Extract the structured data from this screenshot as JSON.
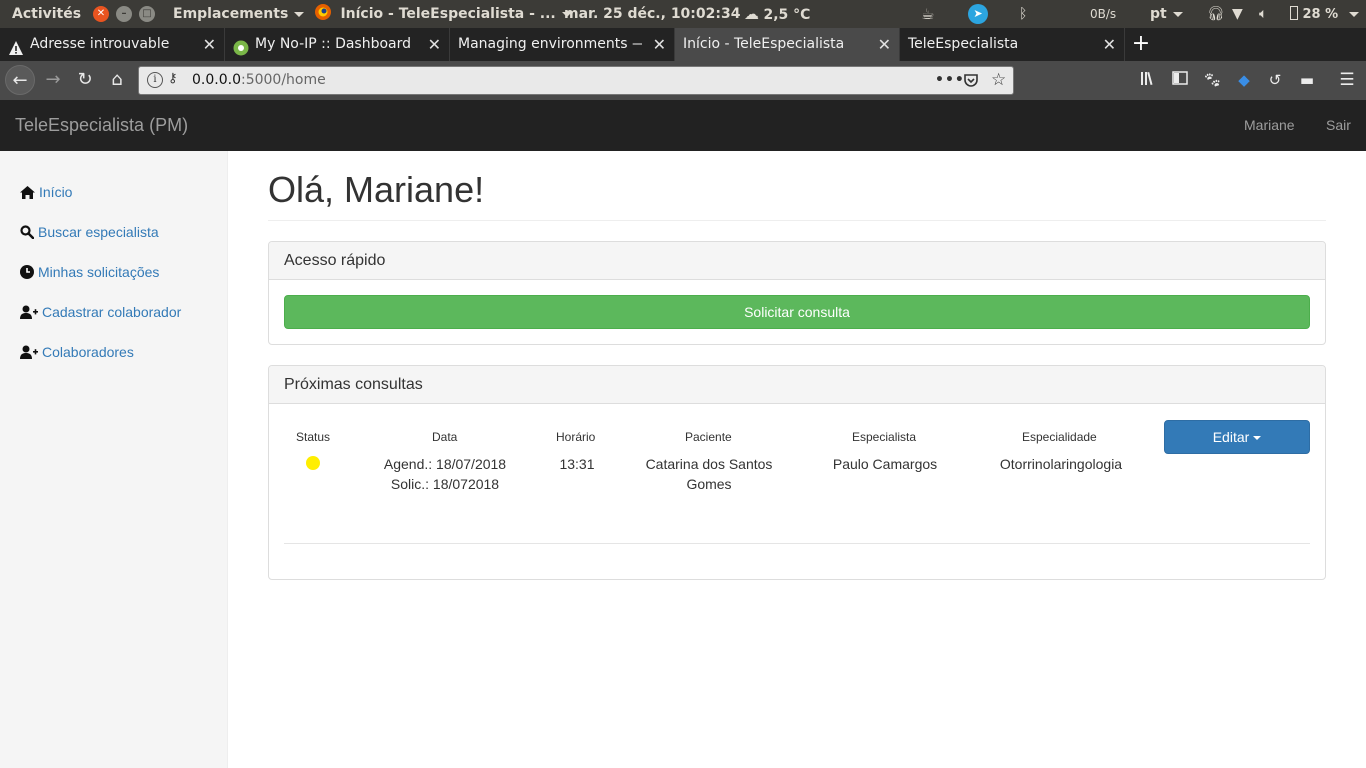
{
  "system_bar": {
    "activities": "Activités",
    "places": "Emplacements",
    "active_app": "Início - TeleEspecialista - ...",
    "datetime": "mar. 25 déc., 10:02:34",
    "weather": "2,5 °C",
    "net_speed": "0B/s",
    "language": "pt",
    "battery": "28 %"
  },
  "tabs": [
    {
      "title": "Adresse introuvable",
      "icon": "warning-icon",
      "active": false
    },
    {
      "title": "My No-IP :: Dashboard",
      "icon": "noip-logo-icon",
      "active": false
    },
    {
      "title": "Managing environments — C",
      "icon": "",
      "active": false
    },
    {
      "title": "Início - TeleEspecialista",
      "icon": "",
      "active": true
    },
    {
      "title": "TeleEspecialista",
      "icon": "",
      "active": false
    }
  ],
  "address_bar": {
    "host": "0.0.0.0",
    "path": ":5000/home"
  },
  "app": {
    "brand": "TeleEspecialista (PM)",
    "user": "Mariane",
    "logout": "Sair"
  },
  "sidebar": {
    "items": [
      {
        "label": "Início",
        "icon": "home-icon"
      },
      {
        "label": "Buscar especialista",
        "icon": "search-icon"
      },
      {
        "label": "Minhas solicitações",
        "icon": "clock-icon"
      },
      {
        "label": "Cadastrar colaborador",
        "icon": "add-user-icon"
      },
      {
        "label": "Colaboradores",
        "icon": "add-user-icon"
      }
    ]
  },
  "main": {
    "greeting": "Olá, Mariane!",
    "quick_access": {
      "heading": "Acesso rápido",
      "button": "Solicitar consulta"
    },
    "upcoming": {
      "heading": "Próximas consultas",
      "columns": [
        "Status",
        "Data",
        "Horário",
        "Paciente",
        "Especialista",
        "Especialidade"
      ],
      "rows": [
        {
          "status_color": "#ffee00",
          "date_scheduled": "Agend.: 18/07/2018",
          "date_requested": "Solic.: 18/072018",
          "time": "13:31",
          "patient": "Catarina dos Santos Gomes",
          "specialist": "Paulo Camargos",
          "specialty": "Otorrinolaringologia",
          "action": "Editar"
        }
      ]
    }
  },
  "colors": {
    "link": "#337ab7",
    "success": "#5cb85c",
    "primary": "#337ab7",
    "app_nav": "#222222"
  }
}
